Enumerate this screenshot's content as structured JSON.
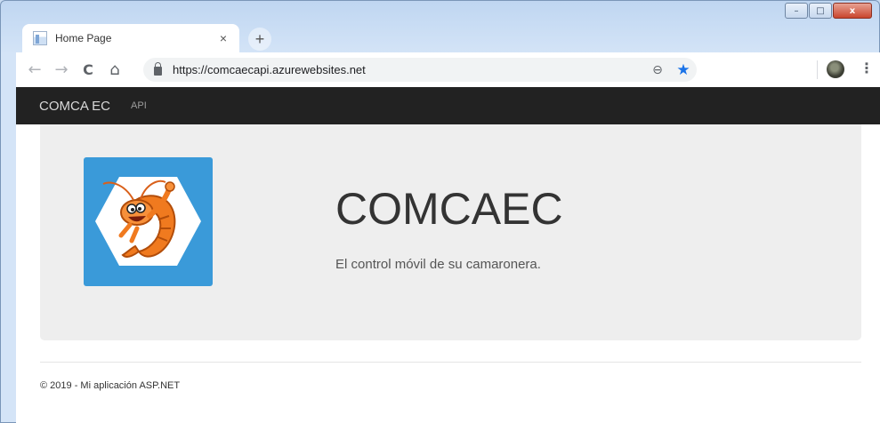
{
  "browser": {
    "tab": {
      "title": "Home Page",
      "close_glyph": "×"
    },
    "new_tab_glyph": "+",
    "address": {
      "url": "https://comcaecapi.azurewebsites.net"
    },
    "window_controls": {
      "minimize": "–",
      "maximize": "□",
      "close": "x"
    },
    "nav": {
      "back": "←",
      "forward": "→",
      "reload": "C",
      "home": "⌂"
    },
    "zoom_glyph": "⊖",
    "star_glyph": "★",
    "menu_glyph": "⋮"
  },
  "site": {
    "navbar": {
      "brand": "COMCA EC",
      "links": [
        "API"
      ]
    },
    "jumbotron": {
      "title": "COMCAEC",
      "lead": "El control móvil de su camaronera."
    },
    "footer": {
      "text": "© 2019 - Mi aplicación ASP.NET"
    }
  },
  "icons": [
    "favicon-icon",
    "lock-icon",
    "zoom-icon",
    "star-icon",
    "profile-icon",
    "menu-icon",
    "shrimp-logo-icon"
  ],
  "colors": {
    "navbar_bg": "#222222",
    "jumbotron_bg": "#eeeeee",
    "logo_bg": "#3a9ad9",
    "star": "#1a73e8"
  }
}
